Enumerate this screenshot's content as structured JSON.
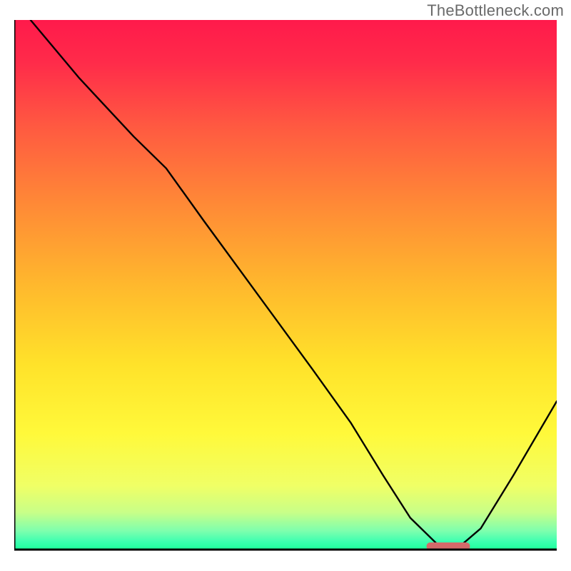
{
  "watermark": "TheBottleneck.com",
  "chart_data": {
    "type": "line",
    "title": "",
    "xlabel": "",
    "ylabel": "",
    "xlim": [
      0,
      100
    ],
    "ylim": [
      0,
      100
    ],
    "series": [
      {
        "name": "curve",
        "x": [
          3,
          12,
          22,
          28,
          35,
          45,
          55,
          62,
          68,
          73,
          78,
          82,
          86,
          92,
          100
        ],
        "y": [
          100,
          89,
          78,
          72,
          62,
          48,
          34,
          24,
          14,
          6,
          1,
          0.5,
          4,
          14,
          28
        ]
      }
    ],
    "marker": {
      "name": "optimum-marker",
      "x_start": 76,
      "x_end": 84,
      "y": 0.6,
      "color": "#d46a6a"
    },
    "gradient_stops": [
      {
        "offset": 0.0,
        "color": "#ff1a4b"
      },
      {
        "offset": 0.08,
        "color": "#ff2b4a"
      },
      {
        "offset": 0.2,
        "color": "#ff5941"
      },
      {
        "offset": 0.35,
        "color": "#ff8a36"
      },
      {
        "offset": 0.5,
        "color": "#ffb82d"
      },
      {
        "offset": 0.65,
        "color": "#ffe22a"
      },
      {
        "offset": 0.78,
        "color": "#fff93a"
      },
      {
        "offset": 0.88,
        "color": "#f0ff66"
      },
      {
        "offset": 0.93,
        "color": "#c8ff88"
      },
      {
        "offset": 0.965,
        "color": "#7dffae"
      },
      {
        "offset": 0.985,
        "color": "#3dffb0"
      },
      {
        "offset": 1.0,
        "color": "#1cff9c"
      }
    ],
    "axis_color": "#000000",
    "curve_color": "#000000",
    "curve_width": 2.4
  }
}
